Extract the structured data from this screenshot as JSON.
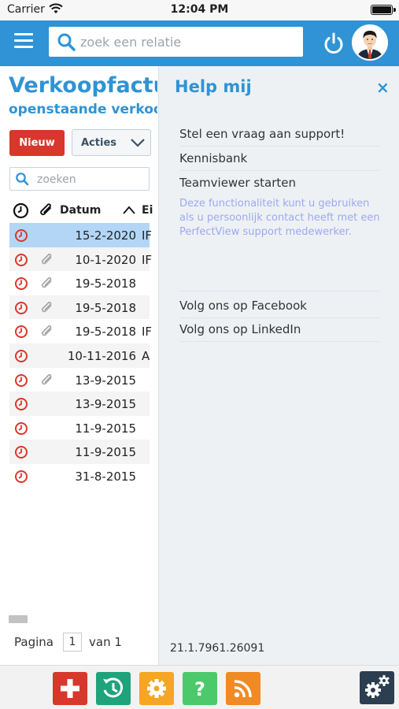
{
  "status_bar": {
    "carrier": "Carrier",
    "time": "12:04 PM",
    "icons": [
      "wifi-icon",
      "battery-icon"
    ]
  },
  "top_bar": {
    "menu_icon": "hamburger-icon",
    "search": {
      "placeholder": "zoek een relatie",
      "value": ""
    },
    "power_icon": "power-icon",
    "avatar": "user-avatar"
  },
  "left_panel": {
    "title": "Verkoopfactu",
    "subtitle": "openstaande verkoo",
    "new_button": "Nieuw",
    "actions_button": "Acties",
    "search": {
      "placeholder": "zoeken",
      "value": ""
    },
    "columns": {
      "date": "Datum",
      "second": "Ei"
    },
    "rows": [
      {
        "date": "15-2-2020",
        "extra": "IF",
        "attachment": false,
        "selected": true
      },
      {
        "date": "10-1-2020",
        "extra": "IF",
        "attachment": true,
        "selected": false
      },
      {
        "date": "19-5-2018",
        "extra": "",
        "attachment": true,
        "selected": false
      },
      {
        "date": "19-5-2018",
        "extra": "",
        "attachment": true,
        "selected": false
      },
      {
        "date": "19-5-2018",
        "extra": "IF",
        "attachment": true,
        "selected": false
      },
      {
        "date": "10-11-2016",
        "extra": "A",
        "attachment": false,
        "selected": false
      },
      {
        "date": "13-9-2015",
        "extra": "",
        "attachment": true,
        "selected": false
      },
      {
        "date": "13-9-2015",
        "extra": "",
        "attachment": false,
        "selected": false
      },
      {
        "date": "11-9-2015",
        "extra": "",
        "attachment": false,
        "selected": false
      },
      {
        "date": "11-9-2015",
        "extra": "",
        "attachment": false,
        "selected": false
      },
      {
        "date": "31-8-2015",
        "extra": "",
        "attachment": false,
        "selected": false
      }
    ],
    "pager": {
      "label": "Pagina",
      "current": "1",
      "of_label": "van 1"
    }
  },
  "help_panel": {
    "title": "Help mij",
    "close": "×",
    "links": [
      "Stel een vraag aan support!",
      "Kennisbank",
      "Teamviewer starten"
    ],
    "note": "Deze functionaliteit kunt u gebruiken als u persoonlijk contact heeft met een PerfectView support medewerker.",
    "social_links": [
      "Volg ons op Facebook",
      "Volg ons op LinkedIn"
    ],
    "version": "21.1.7961.26091"
  },
  "bottom_toolbar": {
    "buttons": [
      {
        "icon": "plus-icon",
        "color": "#d8372c"
      },
      {
        "icon": "history-icon",
        "color": "#1fa37a"
      },
      {
        "icon": "gear-icon",
        "color": "#f5a623"
      },
      {
        "icon": "help-icon",
        "color": "#4cc96b"
      },
      {
        "icon": "rss-icon",
        "color": "#f08a24"
      },
      {
        "icon": "settings-gears-icon",
        "color": "#2c3e50"
      }
    ]
  },
  "colors": {
    "brand": "#2f93d5",
    "danger": "#d8372c",
    "selected_row": "#b3d6f6"
  }
}
